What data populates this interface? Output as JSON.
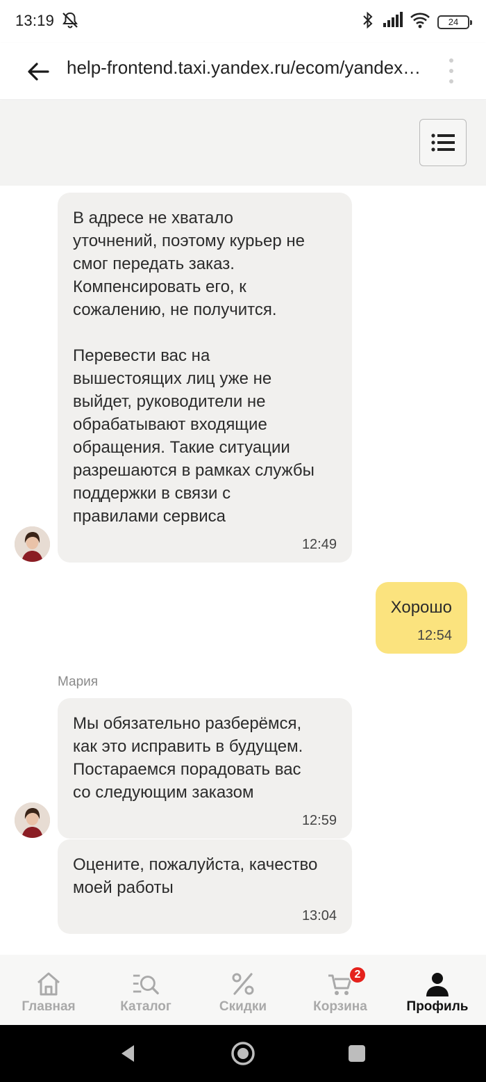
{
  "status_bar": {
    "time": "13:19",
    "battery": "24"
  },
  "browser": {
    "url": "help-frontend.taxi.yandex.ru/ecom/yandex…"
  },
  "chat": {
    "messages": [
      {
        "direction": "incoming",
        "text": "В адресе не хватало\nуточнений, поэтому курьер не\nсмог передать заказ.\nКомпенсировать его, к\nсожалению, не получится.\n\nПеревести вас на\nвышестоящих лиц уже не\nвыйдет, руководители не\nобрабатывают входящие\nобращения. Такие ситуации\nразрешаются в рамках службы\nподдержки в связи с\nправилами сервиса",
        "time": "12:49"
      },
      {
        "direction": "outgoing",
        "text": "Хорошо",
        "time": "12:54"
      },
      {
        "direction": "incoming",
        "sender": "Мария",
        "text": "Мы обязательно разберёмся,\nкак это исправить в будущем.\nПостараемся порадовать вас\nсо следующим заказом",
        "time": "12:59"
      },
      {
        "direction": "incoming",
        "text": "Оцените, пожалуйста, качество\nмоей работы",
        "time": "13:04"
      }
    ]
  },
  "tabs": [
    {
      "label": "Главная",
      "icon": "home-icon",
      "active": false
    },
    {
      "label": "Каталог",
      "icon": "catalog-search-icon",
      "active": false
    },
    {
      "label": "Скидки",
      "icon": "percent-icon",
      "active": false
    },
    {
      "label": "Корзина",
      "icon": "cart-icon",
      "active": false,
      "badge": "2"
    },
    {
      "label": "Профиль",
      "icon": "profile-icon",
      "active": true
    }
  ],
  "colors": {
    "outgoing_bubble": "#fbe37e",
    "incoming_bubble": "#f1f0ee",
    "badge": "#e5221c"
  }
}
